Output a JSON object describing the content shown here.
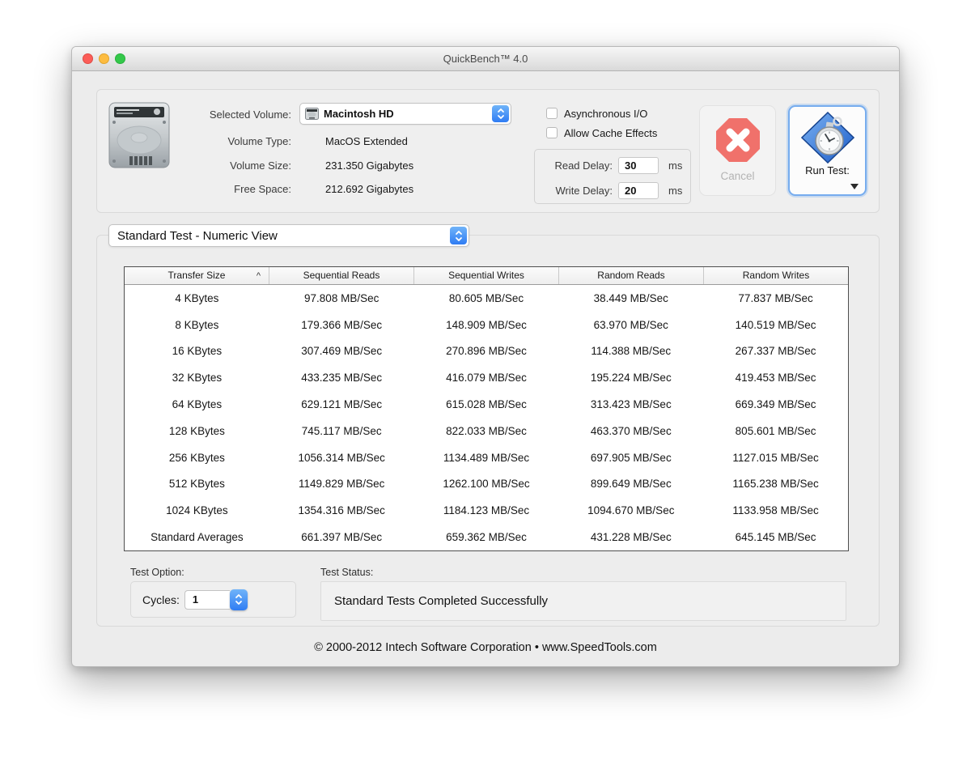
{
  "window": {
    "title": "QuickBench™ 4.0"
  },
  "volume": {
    "selected_label": "Selected Volume:",
    "selected_value": "Macintosh HD",
    "type_label": "Volume Type:",
    "type_value": "MacOS Extended",
    "size_label": "Volume Size:",
    "size_value": "231.350 Gigabytes",
    "free_label": "Free Space:",
    "free_value": "212.692 Gigabytes"
  },
  "options": {
    "async_label": "Asynchronous I/O",
    "cache_label": "Allow Cache Effects",
    "read_delay_label": "Read Delay:",
    "read_delay_value": "30",
    "write_delay_label": "Write Delay:",
    "write_delay_value": "20",
    "ms": "ms"
  },
  "buttons": {
    "cancel": "Cancel",
    "run_test": "Run Test:"
  },
  "view_selector": {
    "value": "Standard Test - Numeric View"
  },
  "results_table": {
    "sort_indicator": "^",
    "columns": [
      "Transfer Size",
      "Sequential Reads",
      "Sequential Writes",
      "Random Reads",
      "Random Writes"
    ],
    "rows": [
      [
        "4 KBytes",
        "97.808 MB/Sec",
        "80.605 MB/Sec",
        "38.449 MB/Sec",
        "77.837 MB/Sec"
      ],
      [
        "8 KBytes",
        "179.366 MB/Sec",
        "148.909 MB/Sec",
        "63.970 MB/Sec",
        "140.519 MB/Sec"
      ],
      [
        "16 KBytes",
        "307.469 MB/Sec",
        "270.896 MB/Sec",
        "114.388 MB/Sec",
        "267.337 MB/Sec"
      ],
      [
        "32 KBytes",
        "433.235 MB/Sec",
        "416.079 MB/Sec",
        "195.224 MB/Sec",
        "419.453 MB/Sec"
      ],
      [
        "64 KBytes",
        "629.121 MB/Sec",
        "615.028 MB/Sec",
        "313.423 MB/Sec",
        "669.349 MB/Sec"
      ],
      [
        "128 KBytes",
        "745.117 MB/Sec",
        "822.033 MB/Sec",
        "463.370 MB/Sec",
        "805.601 MB/Sec"
      ],
      [
        "256 KBytes",
        "1056.314 MB/Sec",
        "1134.489 MB/Sec",
        "697.905 MB/Sec",
        "1127.015 MB/Sec"
      ],
      [
        "512 KBytes",
        "1149.829 MB/Sec",
        "1262.100 MB/Sec",
        "899.649 MB/Sec",
        "1165.238 MB/Sec"
      ],
      [
        "1024 KBytes",
        "1354.316 MB/Sec",
        "1184.123 MB/Sec",
        "1094.670 MB/Sec",
        "1133.958 MB/Sec"
      ],
      [
        "Standard Averages",
        "661.397 MB/Sec",
        "659.362 MB/Sec",
        "431.228 MB/Sec",
        "645.145 MB/Sec"
      ]
    ]
  },
  "test_option": {
    "label": "Test Option:",
    "cycles_label": "Cycles:",
    "cycles_value": "1"
  },
  "test_status": {
    "label": "Test Status:",
    "message": "Standard Tests Completed Successfully"
  },
  "footer": {
    "text": "© 2000-2012 Intech Software Corporation • www.SpeedTools.com"
  },
  "colors": {
    "accent_blue": "#2f7cf3",
    "cancel_red": "#f0716b",
    "traffic_red": "#fc5d58",
    "traffic_yellow": "#fdbc40",
    "traffic_green": "#34c84a"
  }
}
